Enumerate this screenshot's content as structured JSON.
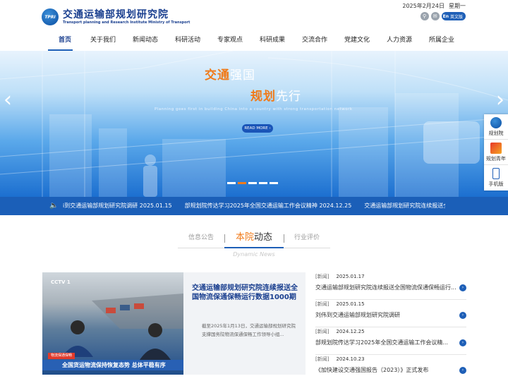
{
  "header": {
    "org_name_cn": "交通运输部规划研究院",
    "org_name_en": "Transport planning and Research Institute Ministry of Transport",
    "logo_mark": "TPRI",
    "date": "2025年2月24日",
    "weekday": "星期一",
    "lang_badge": "En",
    "lang_label": "英文版",
    "icons": [
      "search-icon",
      "mail-icon"
    ]
  },
  "nav": {
    "items": [
      {
        "label": "首页",
        "active": true
      },
      {
        "label": "关于我们"
      },
      {
        "label": "新闻动态"
      },
      {
        "label": "科研活动"
      },
      {
        "label": "专家观点"
      },
      {
        "label": "科研成果"
      },
      {
        "label": "交流合作"
      },
      {
        "label": "党建文化"
      },
      {
        "label": "人力资源"
      },
      {
        "label": "所属企业"
      }
    ]
  },
  "banner": {
    "line1_hl": "交通",
    "line1_rest": "强国",
    "line2_hl": "规划",
    "line2_rest": "先行",
    "subtitle_en": "Planning goes first in building China into a country with strong transportation network",
    "readmore": "READ MORE ›",
    "slides": 5,
    "active_slide": 2
  },
  "sidefloat": [
    {
      "label": "规划院",
      "icon": "institute-logo-icon"
    },
    {
      "label": "规划青年",
      "icon": "youth-logo-icon"
    },
    {
      "label": "手机版",
      "icon": "mobile-icon"
    }
  ],
  "ticker": {
    "items": [
      "i到交通运输部规划研究院调研 2025.01.15",
      "部规划院传达学习2025年全国交通运输工作会议精神 2024.12.25",
      "交通运输部规划研究院连续报送全国"
    ]
  },
  "tabs": {
    "left": "信息公告",
    "active_hl": "本院",
    "active_rest": "动态",
    "right": "行业评价",
    "sub": "Dynamic News"
  },
  "feature": {
    "title": "交通运输部规划研究院连续报送全国物流保通保畅运行数据1000期",
    "desc": "截至2025年1月13日，交通运输部规划研究院支撑国务院物流保通保畅工作领导小组...",
    "img_logo": "CCTV 1",
    "img_tag": "物流保通保畅",
    "img_caption": "全国货运物流保持恢复态势 总体平稳有序"
  },
  "news": [
    {
      "cat": "[新闻]",
      "date": "2025.01.17",
      "title": "交通运输部规划研究院连续报送全国物流保通保畅运行..."
    },
    {
      "cat": "[新闻]",
      "date": "2025.01.15",
      "title": "刘伟到交通运输部规划研究院调研"
    },
    {
      "cat": "[新闻]",
      "date": "2024.12.25",
      "title": "部规划院传达学习2025年全国交通运输工作会议精..."
    },
    {
      "cat": "[新闻]",
      "date": "2024.10.23",
      "title": "《加快建设交通强国报告（2023）》正式发布"
    }
  ],
  "colors": {
    "brand_blue": "#1e5fb7",
    "accent_orange": "#f07a19",
    "dark_blue": "#1a3f8f"
  }
}
